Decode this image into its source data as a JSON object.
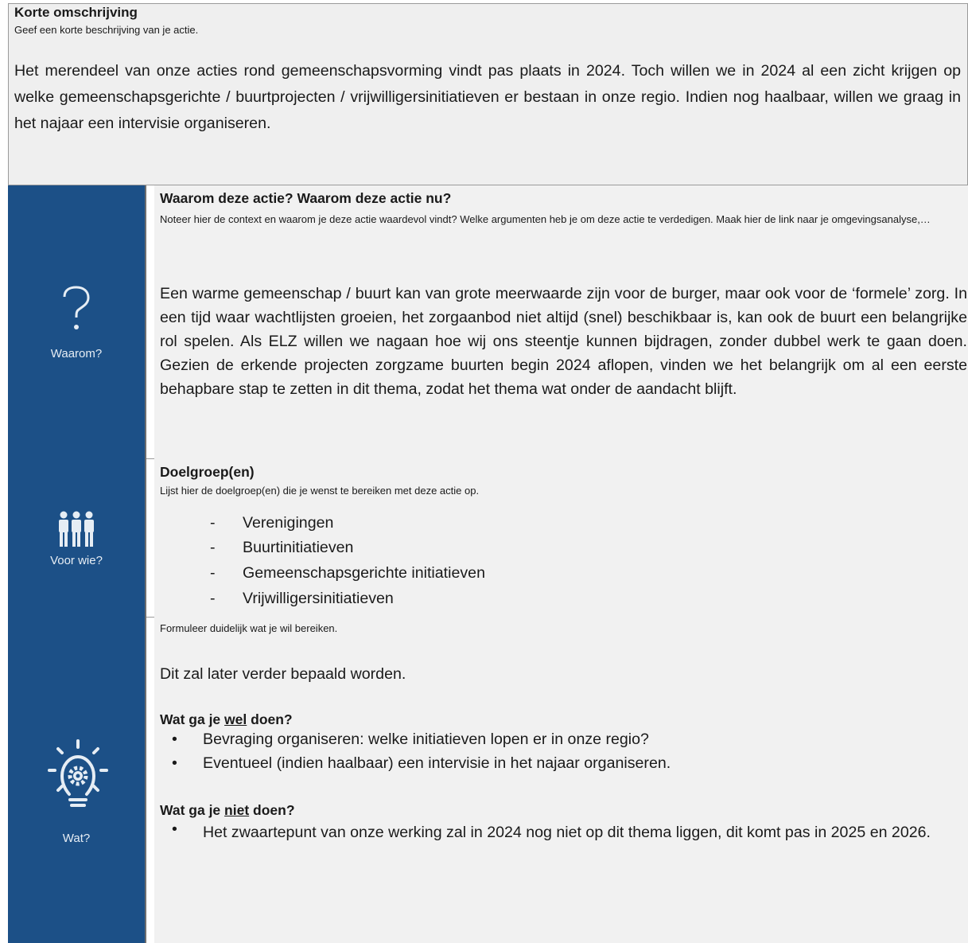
{
  "top": {
    "title": "Korte omschrijving",
    "hint": "Geef een korte beschrijving van je actie.",
    "body": "Het merendeel van onze acties rond gemeenschapsvorming vindt pas plaats in 2024. Toch willen we in 2024 al een zicht krijgen op welke gemeenschapsgerichte / buurtprojecten / vrijwilligersinitiatieven er bestaan in onze regio. Indien nog haalbaar, willen we graag in het najaar een intervisie organiseren."
  },
  "waarom": {
    "side_label": "Waarom?",
    "icon": "question-mark-icon",
    "heading": "Waarom deze actie? Waarom deze actie nu?",
    "hint": "Noteer hier de context en waarom je deze actie waardevol vindt? Welke argumenten heb je om deze actie te verdedigen. Maak hier de link naar je omgevingsanalyse,…",
    "body": "Een warme gemeenschap / buurt kan van grote meerwaarde zijn voor de burger, maar ook voor de ‘formele’ zorg. In een tijd waar wachtlijsten groeien, het zorgaanbod niet altijd (snel) beschikbaar is, kan ook de buurt een belangrijke rol spelen. Als ELZ willen we nagaan hoe wij ons steentje kunnen bijdragen, zonder dubbel werk te gaan doen. Gezien de erkende projecten zorgzame buurten begin 2024 aflopen, vinden we het belangrijk om al een eerste behapbare stap te zetten in dit thema, zodat het thema wat onder de aandacht blijft."
  },
  "doelgroep": {
    "side_label": "Voor wie?",
    "icon": "people-group-icon",
    "heading": "Doelgroep(en)",
    "hint": "Lijst hier de doelgroep(en) die je wenst te bereiken met deze actie op.",
    "items": [
      "Verenigingen",
      "Buurtinitiatieven",
      "Gemeenschapsgerichte initiatieven",
      "Vrijwilligersinitiatieven"
    ]
  },
  "wat": {
    "side_label": "Wat?",
    "icon": "lightbulb-gear-icon",
    "hint": "Formuleer duidelijk wat je wil bereiken.",
    "intro": "Dit zal later verder bepaald worden.",
    "wel_heading_pre": "Wat ga je ",
    "wel_heading_em": "wel",
    "wel_heading_post": " doen?",
    "wel_items": [
      "Bevraging organiseren: welke initiatieven lopen er in onze regio?",
      "Eventueel (indien haalbaar) een intervisie in het najaar organiseren."
    ],
    "niet_heading_pre": "Wat ga je ",
    "niet_heading_em": "niet",
    "niet_heading_post": " doen?",
    "niet_items": [
      "Het zwaartepunt van onze werking zal in 2024 nog niet op dit thema liggen, dit komt pas in 2025 en 2026."
    ]
  }
}
